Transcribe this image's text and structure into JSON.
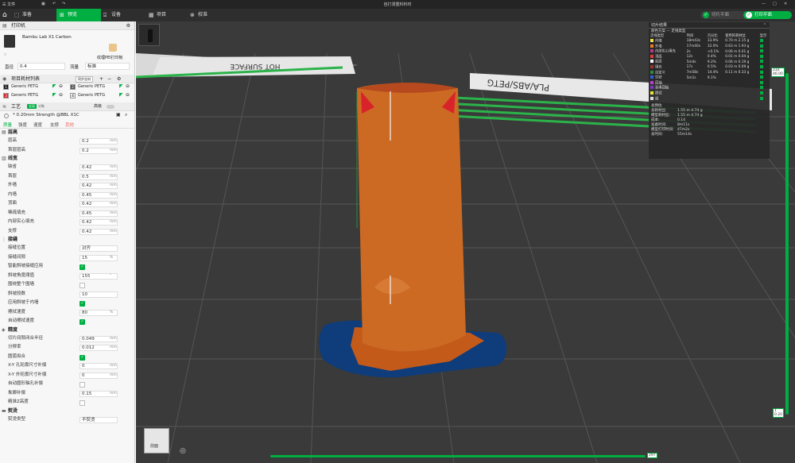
{
  "titlebar": {
    "menu": "文件",
    "title": "自打漫重料料时"
  },
  "nav": {
    "tabs": [
      "准备",
      "预览",
      "设备",
      "项目",
      "校准"
    ],
    "active": 1,
    "slice_btn": "切片平面",
    "print_btn": "打印平面"
  },
  "printer": {
    "section": "打印机",
    "name": "Bambu Lab X1 Carbon",
    "plate": "纹理PEI打印板",
    "nozzle_label": "直径",
    "nozzle": "0.4",
    "flow_label": "流量",
    "flow": "标准"
  },
  "filament": {
    "section": "项目耗材列表",
    "sync": "同步丝材",
    "items": [
      {
        "n": "1",
        "name": "Generic PETG",
        "color": "#1a1a1a"
      },
      {
        "n": "2",
        "name": "Generic PETG",
        "color": "#555555"
      },
      {
        "n": "3",
        "name": "Generic PETG",
        "color": "#d8232a"
      },
      {
        "n": "4",
        "name": "Generic PETG",
        "color": "#f0f0f0"
      }
    ]
  },
  "process": {
    "section": "工艺",
    "global": "全局",
    "object": "对象",
    "advanced": "高级",
    "preset": "* 0.20mm Strength @BBL X1C",
    "subtabs": [
      "质量",
      "强度",
      "速度",
      "支撑",
      "其他"
    ]
  },
  "quality": {
    "layer_group": "层高",
    "layer_rows": [
      [
        "层高",
        "0.2",
        "mm"
      ],
      [
        "首层层高",
        "0.2",
        "mm"
      ]
    ],
    "width_group": "线宽",
    "width_rows": [
      [
        "缺省",
        "0.42",
        "mm"
      ],
      [
        "首层",
        "0.5",
        "mm"
      ],
      [
        "外墙",
        "0.42",
        "mm"
      ],
      [
        "内墙",
        "0.45",
        "mm"
      ],
      [
        "顶面",
        "0.42",
        "mm"
      ],
      [
        "稀疏填充",
        "0.45",
        "mm"
      ],
      [
        "内部实心填充",
        "0.42",
        "mm"
      ],
      [
        "支撑",
        "0.42",
        "mm"
      ]
    ],
    "seam_group": "接缝",
    "seam_rows": [
      {
        "l": "接缝位置",
        "v": "对齐",
        "t": "sel"
      },
      {
        "l": "接缝间隙",
        "v": "15",
        "u": "%",
        "t": "val"
      },
      {
        "l": "智能斜坡接缝应用",
        "t": "cb",
        "on": true
      },
      {
        "l": "斜坡角度阈值",
        "v": "155",
        "u": "°",
        "t": "val"
      },
      {
        "l": "围绕整个围墙",
        "t": "cb",
        "on": false
      },
      {
        "l": "斜坡段数",
        "v": "10",
        "t": "val"
      },
      {
        "l": "应用斜坡于内墙",
        "t": "cb",
        "on": true
      },
      {
        "l": "擦拭速度",
        "v": "80",
        "u": "%",
        "t": "val"
      },
      {
        "l": "自动擦拭速度",
        "t": "cb",
        "on": true
      }
    ],
    "prec_group": "精度",
    "prec_rows": [
      {
        "l": "切片间隙闭合半径",
        "v": "0.049",
        "u": "mm",
        "t": "val"
      },
      {
        "l": "分辨率",
        "v": "0.012",
        "u": "mm",
        "t": "val"
      },
      {
        "l": "圆弧拟合",
        "t": "cb",
        "on": true
      },
      {
        "l": "X-Y 孔轮廓尺寸补偿",
        "v": "0",
        "u": "mm",
        "t": "val"
      },
      {
        "l": "X-Y 外轮廓尺寸补偿",
        "v": "0",
        "u": "mm",
        "t": "val"
      },
      {
        "l": "自动圆形轴孔补偿",
        "t": "cb",
        "on": false
      },
      {
        "l": "象脚补偿",
        "v": "0.15",
        "u": "mm",
        "t": "val"
      },
      {
        "l": "精准Z高度",
        "t": "cb",
        "on": false
      }
    ],
    "ironing_group": "熨烫",
    "ironing_rows": [
      {
        "l": "熨烫类型",
        "v": "不熨烫",
        "t": "sel"
      }
    ]
  },
  "stats": {
    "title": "切片结果",
    "scheme_label": "颜色方案",
    "scheme": "走线类型",
    "cols": [
      "走线类型",
      "时间",
      "百分比",
      "使用的耗材丝",
      "显示"
    ],
    "rows": [
      {
        "name": "内墙",
        "time": "18m43s",
        "pct": "33.9%",
        "used": "0.70 m  2.15 g",
        "color": "#f2e14a"
      },
      {
        "name": "外墙",
        "time": "17m40s",
        "pct": "32.0%",
        "used": "0.63 m  1.93 g",
        "color": "#f07b1f"
      },
      {
        "name": "内部实心填充",
        "time": "2s",
        "pct": "<0.1%",
        "used": "0.06 m  0.01 g",
        "color": "#b03a8f"
      },
      {
        "name": "顶面",
        "time": "12s",
        "pct": "0.4%",
        "used": "0.01 m  0.04 g",
        "color": "#e63939"
      },
      {
        "name": "底面",
        "time": "5m4s",
        "pct": "9.2%",
        "used": "0.06 m  0.19 g",
        "color": "#ffffff"
      },
      {
        "name": "填充",
        "time": "17s",
        "pct": "0.5%",
        "used": "0.03 m  0.09 g",
        "color": "#9a3330"
      },
      {
        "name": "自定义",
        "time": "7m58s",
        "pct": "14.4%",
        "used": "0.11 m  0.33 g",
        "color": "#2b8c3c"
      },
      {
        "name": "空驶",
        "time": "5m1s",
        "pct": "9.1%",
        "used": "",
        "color": "#2f5fd6"
      },
      {
        "name": "回抽",
        "time": "",
        "pct": "",
        "used": "",
        "color": "#c23bd1"
      },
      {
        "name": "装填回抽",
        "time": "",
        "pct": "",
        "used": "",
        "color": "#7e38c7"
      },
      {
        "name": "擦拭",
        "time": "",
        "pct": "",
        "used": "",
        "color": "#e8e832"
      },
      {
        "name": "缝",
        "time": "",
        "pct": "",
        "used": "",
        "color": "#dddddd"
      }
    ],
    "summary_title": "总预估",
    "summary": [
      [
        "总耗材丝:",
        "1.55 m   4.74 g"
      ],
      [
        "模型耗材丝:",
        "1.55 m   4.74 g"
      ],
      [
        "成本:",
        "0.14"
      ],
      [
        "准备时间:",
        "8m11s"
      ],
      [
        "模型打印时间:",
        "47m2s"
      ],
      [
        "总时间:",
        "55m14s"
      ]
    ]
  },
  "slider": {
    "top": "232",
    "top2": "46.00",
    "bottom": "1",
    "bottom2": "0.20",
    "h_value": "297"
  },
  "bed_texts": [
    "HOT SURFACE",
    "PLA/ABS/PETG"
  ],
  "cube_label": "前面"
}
